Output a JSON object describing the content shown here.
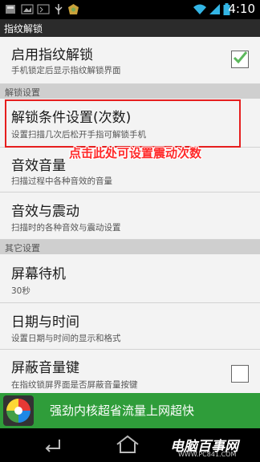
{
  "status_bar": {
    "time": "4:10"
  },
  "action_bar": {
    "title": "指纹解锁"
  },
  "rows": {
    "enable": {
      "title": "启用指纹解锁",
      "subtitle": "手机锁定后显示指纹解锁界面",
      "checked": true
    },
    "condition": {
      "title": "解锁条件设置(次数)",
      "subtitle": "设置扫描几次后松开手指可解锁手机"
    },
    "sound": {
      "title": "音效音量",
      "subtitle": "扫描过程中各种音效的音量"
    },
    "vibrate": {
      "title": "音效与震动",
      "subtitle": "扫描时的各种音效与震动设置"
    },
    "standby": {
      "title": "屏幕待机",
      "subtitle": "30秒"
    },
    "datetime": {
      "title": "日期与时间",
      "subtitle": "设置日期与时间的显示和格式"
    },
    "mute": {
      "title": "屏蔽音量键",
      "subtitle": "在指纹锁屏界面是否屏蔽音量按键",
      "checked": false
    }
  },
  "sections": {
    "unlock": "解锁设置",
    "other": "其它设置"
  },
  "annotation": "点击此处可设置震动次数",
  "banner": {
    "text": "强劲内核超省流量上网超快"
  },
  "watermark": {
    "text": "电脑百事网",
    "url": "WWW.PC841.COM"
  },
  "colors": {
    "accent_green": "#2f9d3a",
    "highlight_red": "#e61e1e",
    "check_green": "#5cb85c"
  }
}
